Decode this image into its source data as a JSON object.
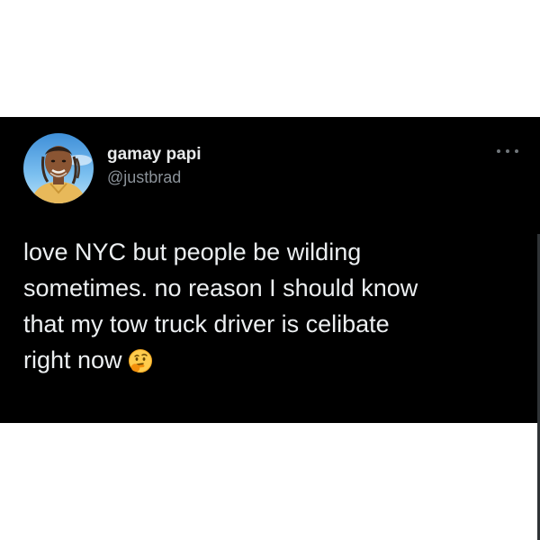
{
  "tweet": {
    "display_name": "gamay papi",
    "handle": "@justbrad",
    "more_icon": "ellipsis-icon",
    "lines": [
      "love NYC but people be wilding",
      "sometimes. no reason I should know",
      "that my tow truck driver is celibate",
      "right now"
    ],
    "emoji": "thinking-face-emoji"
  },
  "colors": {
    "card_background": "#000000",
    "text_primary": "#e7e9ea",
    "text_secondary": "#8b9299",
    "page_background": "#ffffff"
  }
}
